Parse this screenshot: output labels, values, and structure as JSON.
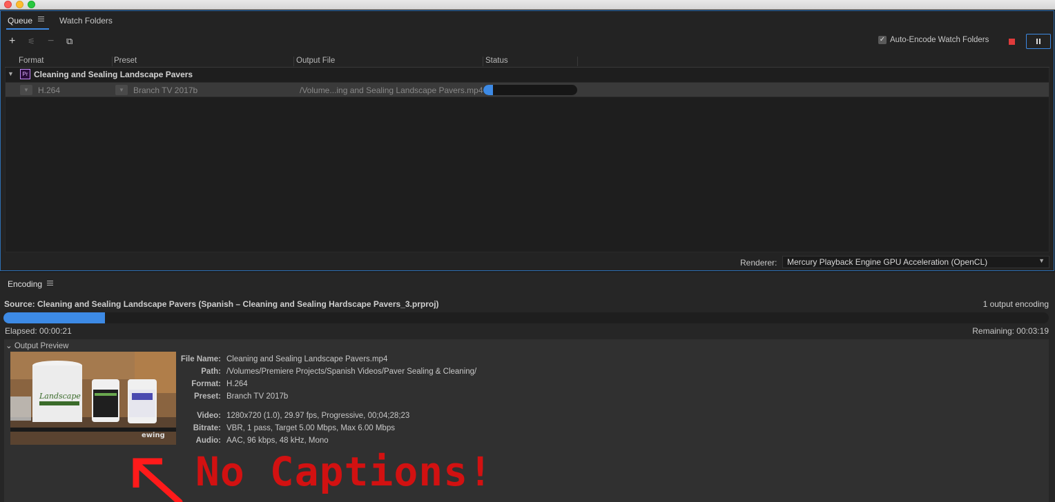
{
  "queue": {
    "tabs": [
      "Queue",
      "Watch Folders"
    ],
    "auto_encode_label": "Auto-Encode Watch Folders",
    "auto_encode_checked": true,
    "columns": [
      "Format",
      "Preset",
      "Output File",
      "Status"
    ],
    "group_title": "Cleaning and Sealing Landscape Pavers",
    "item": {
      "format": "H.264",
      "preset": "Branch TV 2017b",
      "output_file": "/Volume...ing and Sealing Landscape Pavers.mp4",
      "progress": 0.1
    },
    "pr_icon_label": "Pr"
  },
  "renderer": {
    "label": "Renderer:",
    "value": "Mercury Playback Engine GPU Acceleration (OpenCL)"
  },
  "encoding": {
    "tab_label": "Encoding",
    "source": "Source: Cleaning and Sealing Landscape Pavers (Spanish – Cleaning and Sealing Hardscape Pavers_3.prproj)",
    "outputs": "1 output encoding",
    "progress": 0.097,
    "elapsed": "Elapsed: 00:00:21",
    "remaining": "Remaining: 00:03:19",
    "preview_label": "Output Preview",
    "meta": {
      "file_name_k": "File Name:",
      "file_name": "Cleaning and Sealing Landscape Pavers.mp4",
      "path_k": "Path:",
      "path": "/Volumes/Premiere Projects/Spanish Videos/Paver Sealing & Cleaning/",
      "format_k": "Format:",
      "format": "H.264",
      "preset_k": "Preset:",
      "preset": "Branch TV 2017b",
      "video_k": "Video:",
      "video": "1280x720 (1.0), 29.97 fps, Progressive, 00;04;28;23",
      "bitrate_k": "Bitrate:",
      "bitrate": "VBR, 1 pass, Target 5.00 Mbps, Max 6.00 Mbps",
      "audio_k": "Audio:",
      "audio": "AAC, 96 kbps, 48 kHz, Mono"
    },
    "thumb_watermark": "ewing"
  },
  "annotation": "No Captions!",
  "colors": {
    "accent": "#3d8ae5",
    "annotation": "#d21111",
    "stop": "#e03b3b"
  }
}
